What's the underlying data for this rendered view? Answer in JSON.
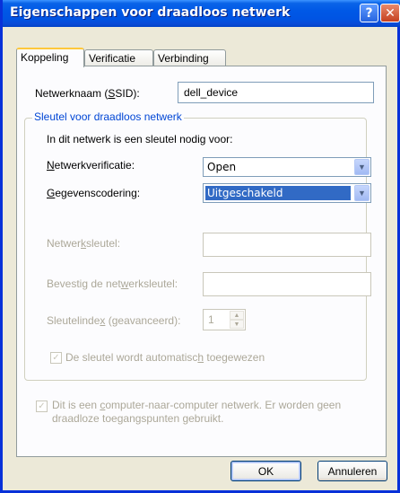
{
  "window": {
    "title": "Eigenschappen voor draadloos netwerk",
    "help_symbol": "?",
    "close_symbol": "✕"
  },
  "tabs": [
    {
      "label": "Koppeling",
      "active": true
    },
    {
      "label": "Verificatie",
      "active": false
    },
    {
      "label": "Verbinding",
      "active": false
    }
  ],
  "ssid": {
    "label_pre": "Netwerknaam (",
    "label_u": "S",
    "label_post": "SID):",
    "value": "dell_device"
  },
  "key_group": {
    "title": "Sleutel voor draadloos netwerk",
    "intro": "In dit netwerk is een sleutel nodig voor:",
    "auth": {
      "label_u": "N",
      "label_rest": "etwerkverificatie:",
      "value": "Open",
      "arrow": "▼"
    },
    "enc": {
      "label_u": "G",
      "label_rest": "egevenscodering:",
      "value": "Uitgeschakeld",
      "arrow": "▼"
    },
    "key": {
      "label_pre": "Netwer",
      "label_u": "k",
      "label_post": "sleutel:",
      "value": ""
    },
    "confirm": {
      "label_pre": "Bevestig de net",
      "label_u": "w",
      "label_post": "erksleutel:",
      "value": ""
    },
    "index": {
      "label_pre": "Sleutelinde",
      "label_u": "x",
      "label_post": " (geavanceerd):",
      "value": "1",
      "up": "▲",
      "down": "▼"
    },
    "auto_key": {
      "label_pre": "De sleutel wordt automatisc",
      "label_u": "h",
      "label_post": " toegewezen",
      "checked": true,
      "check_symbol": "✓"
    }
  },
  "adhoc": {
    "line1_pre": "Dit is een ",
    "line1_u": "c",
    "line1_post": "omputer-naar-computer netwerk. Er worden geen",
    "line2": "draadloze toegangspunten gebruikt.",
    "checked": true,
    "check_symbol": "✓"
  },
  "buttons": {
    "ok": "OK",
    "cancel": "Annuleren"
  },
  "colors": {
    "title_bar": "#0054e3",
    "group_title": "#0046d5",
    "selection": "#316ac5",
    "disabled_text": "#aca899"
  }
}
